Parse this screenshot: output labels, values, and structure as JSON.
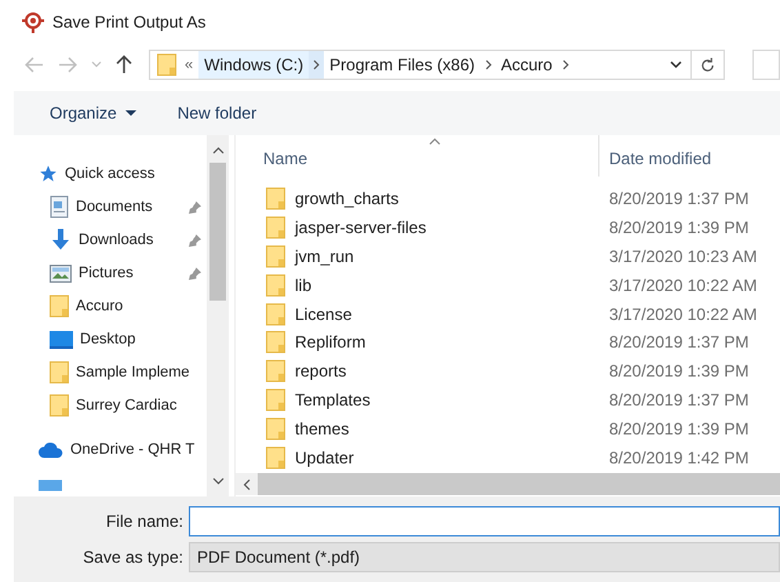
{
  "window": {
    "title": "Save Print Output As"
  },
  "address": {
    "prefix": "«",
    "crumbs": [
      {
        "label": "Windows (C:)",
        "selected": true
      },
      {
        "label": "Program Files (x86)",
        "selected": false
      },
      {
        "label": "Accuro",
        "selected": false
      }
    ]
  },
  "toolbar": {
    "organize": "Organize",
    "new_folder": "New folder"
  },
  "sidebar": {
    "items": [
      {
        "label": "Quick access",
        "kind": "star",
        "pinned": false
      },
      {
        "label": "Documents",
        "kind": "document",
        "pinned": true
      },
      {
        "label": "Downloads",
        "kind": "download",
        "pinned": true
      },
      {
        "label": "Pictures",
        "kind": "pictures",
        "pinned": true
      },
      {
        "label": "Accuro",
        "kind": "folder",
        "pinned": false
      },
      {
        "label": "Desktop",
        "kind": "desktop",
        "pinned": false
      },
      {
        "label": "Sample Impleme",
        "kind": "folder",
        "pinned": false
      },
      {
        "label": "Surrey Cardiac",
        "kind": "folder",
        "pinned": false
      },
      {
        "label": "OneDrive - QHR T",
        "kind": "cloud",
        "pinned": false
      }
    ]
  },
  "table": {
    "columns": [
      "Name",
      "Date modified"
    ],
    "rows": [
      {
        "name": "growth_charts",
        "date": "8/20/2019 1:37 PM"
      },
      {
        "name": "jasper-server-files",
        "date": "8/20/2019 1:39 PM"
      },
      {
        "name": "jvm_run",
        "date": "3/17/2020 10:23 AM"
      },
      {
        "name": "lib",
        "date": "3/17/2020 10:22 AM"
      },
      {
        "name": "License",
        "date": "3/17/2020 10:22 AM"
      },
      {
        "name": "Repliform",
        "date": "8/20/2019 1:37 PM"
      },
      {
        "name": "reports",
        "date": "8/20/2019 1:39 PM"
      },
      {
        "name": "Templates",
        "date": "8/20/2019 1:37 PM"
      },
      {
        "name": "themes",
        "date": "8/20/2019 1:39 PM"
      },
      {
        "name": "Updater",
        "date": "8/20/2019 1:42 PM"
      }
    ]
  },
  "form": {
    "file_name_label": "File name:",
    "save_type_label": "Save as type:",
    "save_type_value": "PDF Document (*.pdf)"
  }
}
